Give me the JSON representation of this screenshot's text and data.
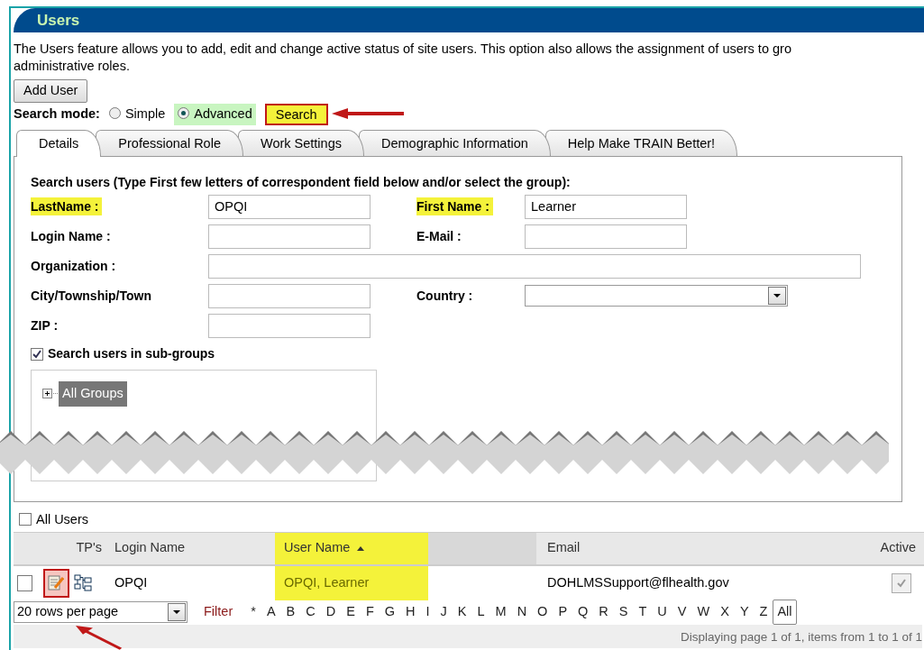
{
  "header": {
    "title": "Users"
  },
  "description_lines": [
    "The Users feature allows you to add, edit and change active status of site users. This option also allows the assignment of users to gro",
    "administrative roles."
  ],
  "add_user_button": "Add User",
  "search_mode": {
    "label": "Search mode:",
    "options": [
      {
        "label": "Simple",
        "selected": false
      },
      {
        "label": "Advanced",
        "selected": true
      }
    ]
  },
  "search_button": {
    "label": "Search",
    "highlighted": true
  },
  "tabs": [
    {
      "label": "Details",
      "selected": true
    },
    {
      "label": "Professional Role",
      "selected": false
    },
    {
      "label": "Work Settings",
      "selected": false
    },
    {
      "label": "Demographic Information",
      "selected": false
    },
    {
      "label": "Help Make TRAIN Better!",
      "selected": false
    }
  ],
  "form": {
    "instruction": "Search users (Type First few letters of correspondent field below and/or select the group):",
    "rows": [
      [
        {
          "label": "LastName :",
          "kind": "text",
          "value": "OPQI",
          "highlighted": true
        },
        {
          "label": "First Name :",
          "kind": "text",
          "value": "Learner",
          "highlighted": true
        }
      ],
      [
        {
          "label": "Login Name :",
          "kind": "text",
          "highlighted": false
        },
        {
          "label": "E-Mail :",
          "kind": "text",
          "highlighted": false
        }
      ],
      [
        {
          "label": "Organization :",
          "kind": "wide",
          "highlighted": false
        }
      ],
      [
        {
          "label": "City/Township/Town",
          "kind": "text",
          "highlighted": false
        },
        {
          "label": "Country :",
          "kind": "select",
          "highlighted": false
        }
      ],
      [
        {
          "label": "ZIP :",
          "kind": "text",
          "highlighted": false
        }
      ]
    ]
  },
  "subgroups": {
    "label": "Search users in sub-groups",
    "checked": true
  },
  "group_tree": [
    {
      "label": "All Groups",
      "selected": true,
      "expanded": false
    }
  ],
  "all_users": {
    "label": "All Users",
    "checked": false
  },
  "table": {
    "columns": [
      {
        "label": "TP's",
        "highlighted": false
      },
      {
        "label": "Login Name",
        "highlighted": false
      },
      {
        "label": "User Name",
        "highlighted": true,
        "sorted": true
      },
      {
        "label": "Email",
        "highlighted": false
      },
      {
        "label": "Active",
        "highlighted": false
      }
    ],
    "rows": [
      {
        "checked": false,
        "login_name": "OPQI",
        "user_name": "OPQI, Learner",
        "email": "DOHLMSSupport@flhealth.gov",
        "active": true
      }
    ]
  },
  "pager": {
    "rows_per_page": "20 rows per page",
    "filter_label": "Filter",
    "letters": [
      {
        "label": "*",
        "selected": false
      },
      {
        "label": "A",
        "selected": false
      },
      {
        "label": "B",
        "selected": false
      },
      {
        "label": "C",
        "selected": false
      },
      {
        "label": "D",
        "selected": false
      },
      {
        "label": "E",
        "selected": false
      },
      {
        "label": "F",
        "selected": false
      },
      {
        "label": "G",
        "selected": false
      },
      {
        "label": "H",
        "selected": false
      },
      {
        "label": "I",
        "selected": false
      },
      {
        "label": "J",
        "selected": false
      },
      {
        "label": "K",
        "selected": false
      },
      {
        "label": "L",
        "selected": false
      },
      {
        "label": "M",
        "selected": false
      },
      {
        "label": "N",
        "selected": false
      },
      {
        "label": "O",
        "selected": false
      },
      {
        "label": "P",
        "selected": false
      },
      {
        "label": "Q",
        "selected": false
      },
      {
        "label": "R",
        "selected": false
      },
      {
        "label": "S",
        "selected": false
      },
      {
        "label": "T",
        "selected": false
      },
      {
        "label": "U",
        "selected": false
      },
      {
        "label": "V",
        "selected": false
      },
      {
        "label": "W",
        "selected": false
      },
      {
        "label": "X",
        "selected": false
      },
      {
        "label": "Y",
        "selected": false
      },
      {
        "label": "Z",
        "selected": false
      },
      {
        "label": "All",
        "selected": true
      }
    ],
    "status": "Displaying page 1 of 1, items from 1 to 1 of 1"
  }
}
